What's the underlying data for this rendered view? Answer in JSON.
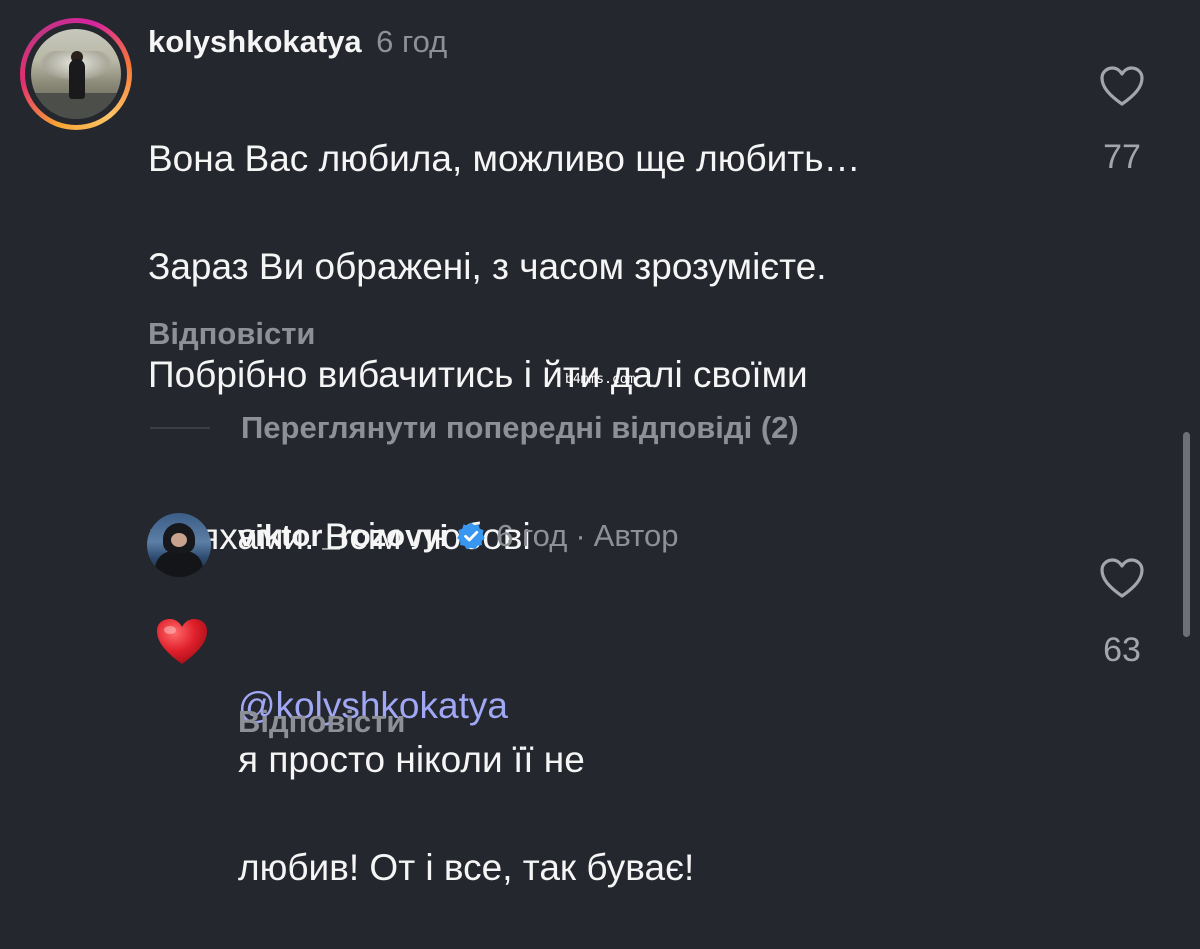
{
  "comments": [
    {
      "username": "kolyshkokatya",
      "time": "6 год",
      "text_lines": [
        "Вона Вас любила, можливо ще любить…",
        "Зараз Ви ображені, з часом зрозумієте.",
        "Побрібно вибачитись і йти далі своїми",
        "шляхами. Всім любові"
      ],
      "emoji": "❤️",
      "like_count": "77",
      "reply_label": "Відповісти"
    },
    {
      "username": "viktor_rozovyi",
      "time": "6 год",
      "separator": "·",
      "author_label": "Автор",
      "mention": "@kolyshkokatya",
      "text_line1_rest": "я просто ніколи її не",
      "text_line2": "любив! От і все, так буває!",
      "like_count": "63",
      "reply_label": "Відповісти"
    }
  ],
  "view_previous_replies": "Переглянути попередні відповіді (2)",
  "watermark": "b4mms.com",
  "icons": {
    "like": "heart-outline-icon",
    "verified": "verified-badge-icon"
  },
  "colors": {
    "background": "#25272e",
    "secondary_text": "#8e9098",
    "mention": "#a0a8f5",
    "verified": "#3897f0",
    "heart": "#e0202b"
  }
}
